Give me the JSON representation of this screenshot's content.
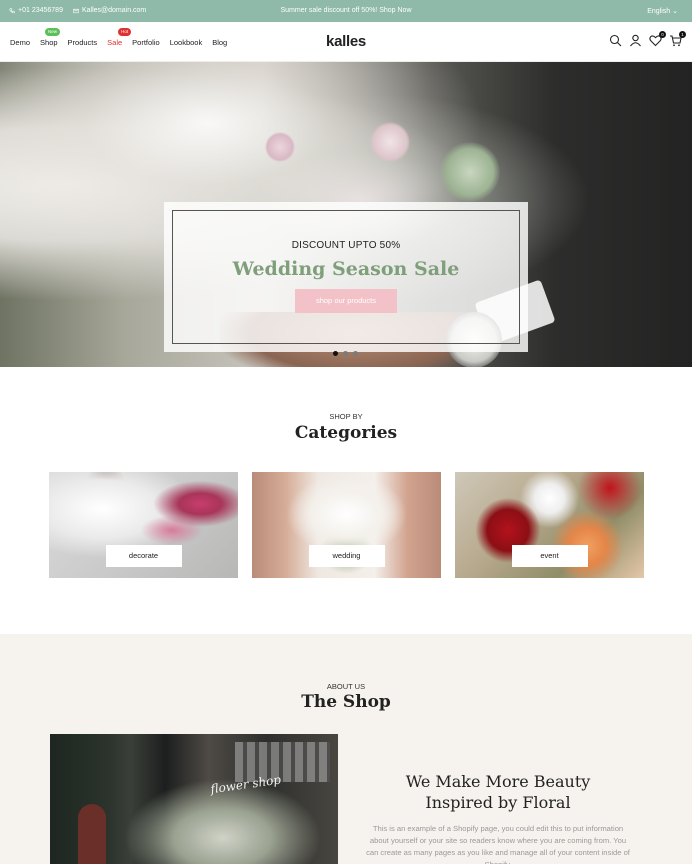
{
  "topbar": {
    "phone": "+01 23456789",
    "email": "Kalles@domain.com",
    "promo": "Summer sale discount off 50%! Shop Now",
    "language": "English"
  },
  "header": {
    "logo": "kalles",
    "nav": [
      {
        "label": "Demo"
      },
      {
        "label": "Shop",
        "badge": "New"
      },
      {
        "label": "Products"
      },
      {
        "label": "Sale",
        "badge": "Hot"
      },
      {
        "label": "Portfolio"
      },
      {
        "label": "Lookbook"
      },
      {
        "label": "Blog"
      }
    ],
    "wishlist_count": "0",
    "cart_count": "1"
  },
  "hero": {
    "kicker": "DISCOUNT UPTO 50%",
    "title": "Wedding Season Sale",
    "button": "shop our products",
    "slides": 3,
    "active_slide": 1,
    "title_color": "#7f9e7a",
    "button_color": "#f2c2c8"
  },
  "categories": {
    "kicker": "SHOP BY",
    "title": "Categories",
    "items": [
      {
        "label": "decorate"
      },
      {
        "label": "wedding"
      },
      {
        "label": "event"
      }
    ]
  },
  "about": {
    "kicker": "ABOUT US",
    "title": "The Shop",
    "photo_sign": "flower shop",
    "heading_line1": "We Make More Beauty",
    "heading_line2": "Inspired by Floral",
    "body": "This is an example of a Shopify page, you could edit this to put information about yourself or your site so readers know where you are coming from. You can create as many pages as you like and manage all of your content inside of Shopify."
  },
  "colors": {
    "topbar_bg": "#8fb9a8",
    "sale_red": "#e03131",
    "new_green": "#5cbf5a"
  }
}
